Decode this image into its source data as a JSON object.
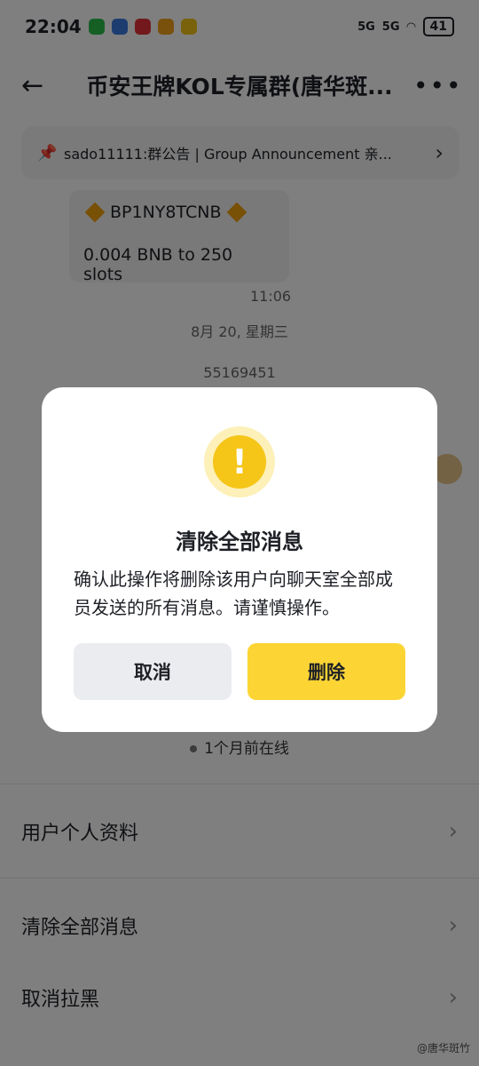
{
  "status": {
    "time": "22:04",
    "signal1": "5G",
    "signal2": "5G",
    "battery": "41",
    "app_colors": [
      "#2bbf4a",
      "#3a7be0",
      "#e6333a",
      "#f3a21a",
      "#f5c518"
    ]
  },
  "header": {
    "title": "币安王牌KOL专属群(唐华斑...",
    "back_icon": "arrow-left-icon",
    "more_icon": "more-dots-icon"
  },
  "announcement": {
    "text": "sado11111:群公告 | Group Announcement  亲..."
  },
  "chat": {
    "message_line1": "BP1NY8TCNB",
    "message_line2": "0.004 BNB to 250 slots",
    "message_time": "11:06",
    "date_separator": "8月 20, 星期三",
    "next_message": "55169451"
  },
  "profile_sheet": {
    "online_status": "1个月前在线",
    "menu": [
      {
        "label": "用户个人资料"
      },
      {
        "label": "清除全部消息"
      },
      {
        "label": "取消拉黑"
      }
    ]
  },
  "dialog": {
    "icon": "warning-icon",
    "title": "清除全部消息",
    "message": "确认此操作将删除该用户向聊天室全部成员发送的所有消息。请谨慎操作。",
    "cancel_label": "取消",
    "delete_label": "删除",
    "accent_color": "#fcd535"
  },
  "watermark": "@唐华斑竹"
}
